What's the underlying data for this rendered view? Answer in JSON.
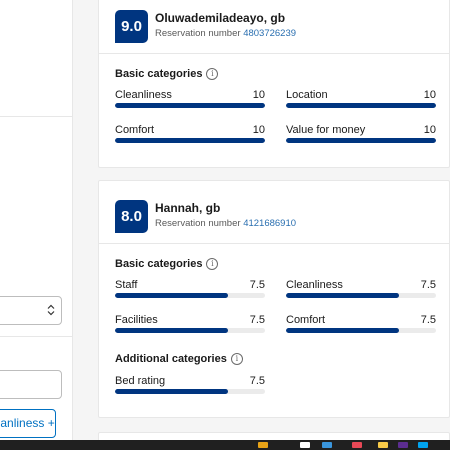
{
  "left_panel": {
    "select_chevron": "⌃⌄",
    "filter_pill_label": "leanliness +"
  },
  "reviews": [
    {
      "score": "9.0",
      "name": "Oluwademiladeayo, gb",
      "reservation_label": "Reservation number",
      "reservation_number": "4803726239",
      "basic_title": "Basic categories",
      "basic": [
        {
          "label": "Cleanliness",
          "value": "10",
          "fill": 1.0
        },
        {
          "label": "Location",
          "value": "10",
          "fill": 1.0
        },
        {
          "label": "Comfort",
          "value": "10",
          "fill": 1.0
        },
        {
          "label": "Value for money",
          "value": "10",
          "fill": 1.0
        }
      ]
    },
    {
      "score": "8.0",
      "name": "Hannah, gb",
      "reservation_label": "Reservation number",
      "reservation_number": "4121686910",
      "basic_title": "Basic categories",
      "basic": [
        {
          "label": "Staff",
          "value": "7.5",
          "fill": 0.75
        },
        {
          "label": "Cleanliness",
          "value": "7.5",
          "fill": 0.75
        },
        {
          "label": "Facilities",
          "value": "7.5",
          "fill": 0.75
        },
        {
          "label": "Comfort",
          "value": "7.5",
          "fill": 0.75
        }
      ],
      "additional_title": "Additional categories",
      "additional": [
        {
          "label": "Bed rating",
          "value": "7.5",
          "fill": 0.75
        }
      ]
    }
  ],
  "colors": {
    "score_bg": "#003580",
    "bar_fill": "#003580",
    "link": "#2a6fb0",
    "taskbar": "#202020"
  }
}
